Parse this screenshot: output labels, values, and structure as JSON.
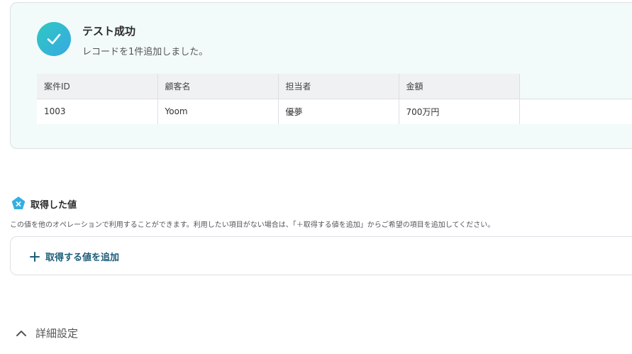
{
  "success": {
    "title": "テスト成功",
    "message": "レコードを1件追加しました。"
  },
  "record_table": {
    "headers": [
      "案件ID",
      "顧客名",
      "担当者",
      "金額"
    ],
    "rows": [
      [
        "1003",
        "Yoom",
        "優夢",
        "700万円"
      ]
    ]
  },
  "acquired_values": {
    "title": "取得した値",
    "icon": "x-badge-icon",
    "description": "この値を他のオペレーションで利用することができます。利用したい項目がない場合は、「＋取得する値を追加」からご希望の項目を追加してください。",
    "add_label": "取得する値を追加"
  },
  "details": {
    "label": "詳細設定"
  },
  "colors": {
    "accent": "#1d5d78",
    "success_gradient_start": "#2fc8c2",
    "success_gradient_end": "#37a9e2",
    "badge": "#35aee0"
  }
}
